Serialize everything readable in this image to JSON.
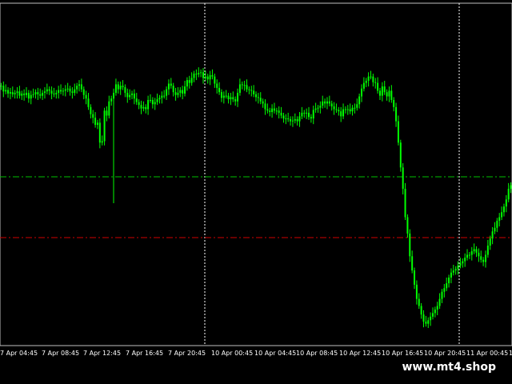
{
  "chart_data": {
    "type": "candlestick",
    "timeframe_note": "",
    "x_labels": [
      "7 Apr 04:45",
      "7 Apr 08:45",
      "7 Apr 12:45",
      "7 Apr 16:45",
      "7 Apr 20:45",
      "10 Apr 00:45",
      "10 Apr 04:45",
      "10 Apr 08:45",
      "10 Apr 12:45",
      "10 Apr 16:45",
      "10 Apr 20:45",
      "11 Apr 00:45",
      "11"
    ],
    "gridlines_vertical_at_labels": [
      "10 Apr 00:45",
      "11 Apr 00:45"
    ],
    "grid": true,
    "price_series_closes": [
      150,
      142,
      144,
      139,
      141,
      138,
      140,
      142,
      136,
      139,
      137,
      140,
      132,
      137,
      138,
      141,
      138,
      136,
      140,
      142,
      145,
      143,
      139,
      138,
      140,
      144,
      142,
      143,
      145,
      146,
      142,
      140,
      145,
      150,
      152,
      145,
      137,
      132,
      120,
      110,
      105,
      95,
      98,
      70,
      72,
      115,
      108,
      128,
      132,
      140,
      152,
      145,
      150,
      148,
      140,
      134,
      137,
      139,
      132,
      127,
      123,
      118,
      120,
      117,
      130,
      130,
      124,
      127,
      131,
      133,
      136,
      136,
      145,
      153,
      150,
      141,
      137,
      140,
      144,
      139,
      149,
      158,
      154,
      161,
      167,
      166,
      168,
      169,
      161,
      163,
      159,
      165,
      163,
      153,
      147,
      141,
      133,
      136,
      136,
      131,
      134,
      131,
      128,
      140,
      152,
      151,
      151,
      145,
      144,
      143,
      138,
      134,
      133,
      128,
      125,
      117,
      115,
      113,
      118,
      115,
      115,
      112,
      108,
      104,
      104,
      103,
      100,
      101,
      103,
      100,
      107,
      112,
      111,
      112,
      106,
      104,
      116,
      118,
      119,
      122,
      128,
      125,
      128,
      125,
      121,
      117,
      116,
      114,
      107,
      117,
      117,
      117,
      114,
      119,
      119,
      124,
      135,
      146,
      154,
      157,
      163,
      163,
      155,
      154,
      143,
      136,
      149,
      141,
      135,
      143,
      130,
      120,
      100,
      70,
      35,
      5,
      -35,
      -58,
      -90,
      -110,
      -130,
      -150,
      -160,
      -172,
      -182,
      -185,
      -180,
      -175,
      -170,
      -165,
      -160,
      -150,
      -140,
      -135,
      -128,
      -120,
      -113,
      -110,
      -108,
      -103,
      -100,
      -97,
      -92,
      -88,
      -88,
      -83,
      -80,
      -85,
      -90,
      -95,
      -98,
      -88,
      -75,
      -65,
      -55,
      -50,
      -40,
      -35,
      -28,
      -20,
      -10,
      5,
      10
    ],
    "horizontal_levels": [
      {
        "color": "#00c000",
        "style": "dash-dot",
        "relative_level": "upper"
      },
      {
        "color": "#d00000",
        "style": "dash-dot",
        "relative_level": "lower"
      }
    ]
  },
  "watermark": {
    "text": "www.mt4.shop"
  },
  "colors": {
    "background": "#000000",
    "candle": "#00ff00",
    "grid": "#ffffff",
    "text": "#ffffff"
  }
}
